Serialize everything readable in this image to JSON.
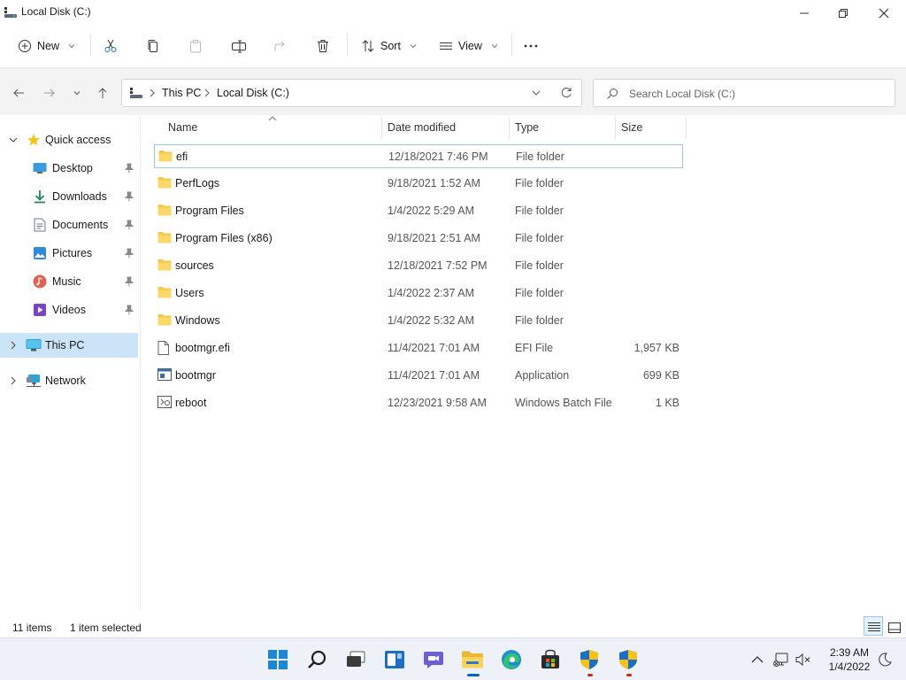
{
  "window": {
    "title": "Local Disk (C:)"
  },
  "toolbar": {
    "new_label": "New",
    "sort_label": "Sort",
    "view_label": "View",
    "more_label": "···"
  },
  "address": {
    "crumbs": [
      "This PC",
      "Local Disk (C:)"
    ]
  },
  "search": {
    "placeholder": "Search Local Disk (C:)"
  },
  "sidebar": {
    "quick_access": "Quick access",
    "items": [
      {
        "label": "Desktop",
        "icon": "desktop-icon",
        "pinned": true
      },
      {
        "label": "Downloads",
        "icon": "downloads-icon",
        "pinned": true
      },
      {
        "label": "Documents",
        "icon": "documents-icon",
        "pinned": true
      },
      {
        "label": "Pictures",
        "icon": "pictures-icon",
        "pinned": true
      },
      {
        "label": "Music",
        "icon": "music-icon",
        "pinned": true
      },
      {
        "label": "Videos",
        "icon": "videos-icon",
        "pinned": true
      }
    ],
    "this_pc": "This PC",
    "network": "Network"
  },
  "columns": {
    "name": "Name",
    "date": "Date modified",
    "type": "Type",
    "size": "Size"
  },
  "files": [
    {
      "name": "efi",
      "date": "12/18/2021 7:46 PM",
      "type": "File folder",
      "size": "",
      "icon": "folder-icon",
      "selected": true
    },
    {
      "name": "PerfLogs",
      "date": "9/18/2021 1:52 AM",
      "type": "File folder",
      "size": "",
      "icon": "folder-icon"
    },
    {
      "name": "Program Files",
      "date": "1/4/2022 5:29 AM",
      "type": "File folder",
      "size": "",
      "icon": "folder-icon"
    },
    {
      "name": "Program Files (x86)",
      "date": "9/18/2021 2:51 AM",
      "type": "File folder",
      "size": "",
      "icon": "folder-icon"
    },
    {
      "name": "sources",
      "date": "12/18/2021 7:52 PM",
      "type": "File folder",
      "size": "",
      "icon": "folder-icon"
    },
    {
      "name": "Users",
      "date": "1/4/2022 2:37 AM",
      "type": "File folder",
      "size": "",
      "icon": "folder-icon"
    },
    {
      "name": "Windows",
      "date": "1/4/2022 5:32 AM",
      "type": "File folder",
      "size": "",
      "icon": "folder-icon"
    },
    {
      "name": "bootmgr.efi",
      "date": "11/4/2021 7:01 AM",
      "type": "EFI File",
      "size": "1,957 KB",
      "icon": "file-icon"
    },
    {
      "name": "bootmgr",
      "date": "11/4/2021 7:01 AM",
      "type": "Application",
      "size": "699 KB",
      "icon": "application-icon"
    },
    {
      "name": "reboot",
      "date": "12/23/2021 9:58 AM",
      "type": "Windows Batch File",
      "size": "1 KB",
      "icon": "batch-file-icon"
    }
  ],
  "status": {
    "count": "11 items",
    "selection": "1 item selected"
  },
  "clock": {
    "time": "2:39 AM",
    "date": "1/4/2022"
  },
  "colors": {
    "accent": "#0067c0",
    "folder": "#f4c94b",
    "selected_nav": "#cce4f7",
    "selected_row_border": "#99c9ef"
  }
}
